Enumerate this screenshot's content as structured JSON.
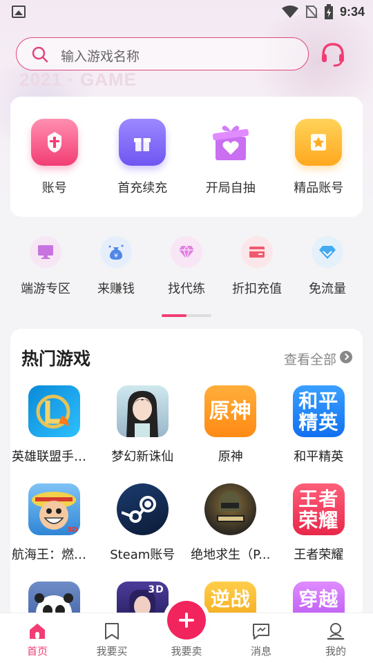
{
  "status_bar": {
    "time": "9:34"
  },
  "hero": {
    "watermark": "2021 · GAME"
  },
  "search": {
    "placeholder": "输入游戏名称"
  },
  "main_menu": [
    {
      "label": "账号",
      "icon": "warrior-helmet-icon"
    },
    {
      "label": "首充续充",
      "icon": "gift-box-icon"
    },
    {
      "label": "开局自抽",
      "icon": "heart-gift-icon"
    },
    {
      "label": "精品账号",
      "icon": "star-card-icon"
    }
  ],
  "sub_menu": [
    {
      "label": "端游专区",
      "icon": "monitor-icon"
    },
    {
      "label": "来赚钱",
      "icon": "money-bag-icon"
    },
    {
      "label": "找代练",
      "icon": "diamond-icon"
    },
    {
      "label": "折扣充值",
      "icon": "card-icon"
    },
    {
      "label": "免流量",
      "icon": "gem-icon"
    }
  ],
  "hot_games": {
    "title": "热门游戏",
    "more": "查看全部",
    "games": [
      {
        "name": "英雄联盟手游...",
        "icon_text": ""
      },
      {
        "name": "梦幻新诛仙",
        "icon_text": ""
      },
      {
        "name": "原神",
        "icon_text": "原神"
      },
      {
        "name": "和平精英",
        "icon_text": "和平精英"
      },
      {
        "name": "航海王：燃烧...",
        "icon_text": ""
      },
      {
        "name": "Steam账号",
        "icon_text": ""
      },
      {
        "name": "绝地求生（P...",
        "icon_text": ""
      },
      {
        "name": "王者荣耀",
        "icon_text": "王者荣耀"
      },
      {
        "name": "",
        "icon_text": ""
      },
      {
        "name": "",
        "icon_text": "3D"
      },
      {
        "name": "",
        "icon_text": "逆战"
      },
      {
        "name": "",
        "icon_text": "穿越"
      }
    ]
  },
  "bottom_nav": [
    {
      "label": "首页",
      "active": true
    },
    {
      "label": "我要买"
    },
    {
      "label": "我要卖"
    },
    {
      "label": "消息"
    },
    {
      "label": "我的"
    }
  ],
  "colors": {
    "accent": "#f23d74"
  }
}
